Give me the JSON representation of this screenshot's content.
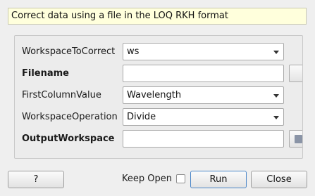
{
  "description": "Correct data using a file in the LOQ RKH format",
  "properties": [
    {
      "label": "WorkspaceToCorrect",
      "value": "ws",
      "type": "combo"
    },
    {
      "label": "Filename",
      "value": "",
      "type": "text-with-browse"
    },
    {
      "label": "FirstColumnValue",
      "value": "Wavelength",
      "type": "combo"
    },
    {
      "label": "WorkspaceOperation",
      "value": "Divide",
      "type": "combo"
    },
    {
      "label": "OutputWorkspace",
      "value": "",
      "type": "text-with-button"
    }
  ],
  "footer": {
    "help_label": "?",
    "keep_open_label": "Keep Open",
    "keep_open_checked": false,
    "run_label": "Run",
    "close_label": "Close"
  },
  "icons": {
    "dropdown": "chevron-down-icon",
    "output": "workspace-icon"
  }
}
